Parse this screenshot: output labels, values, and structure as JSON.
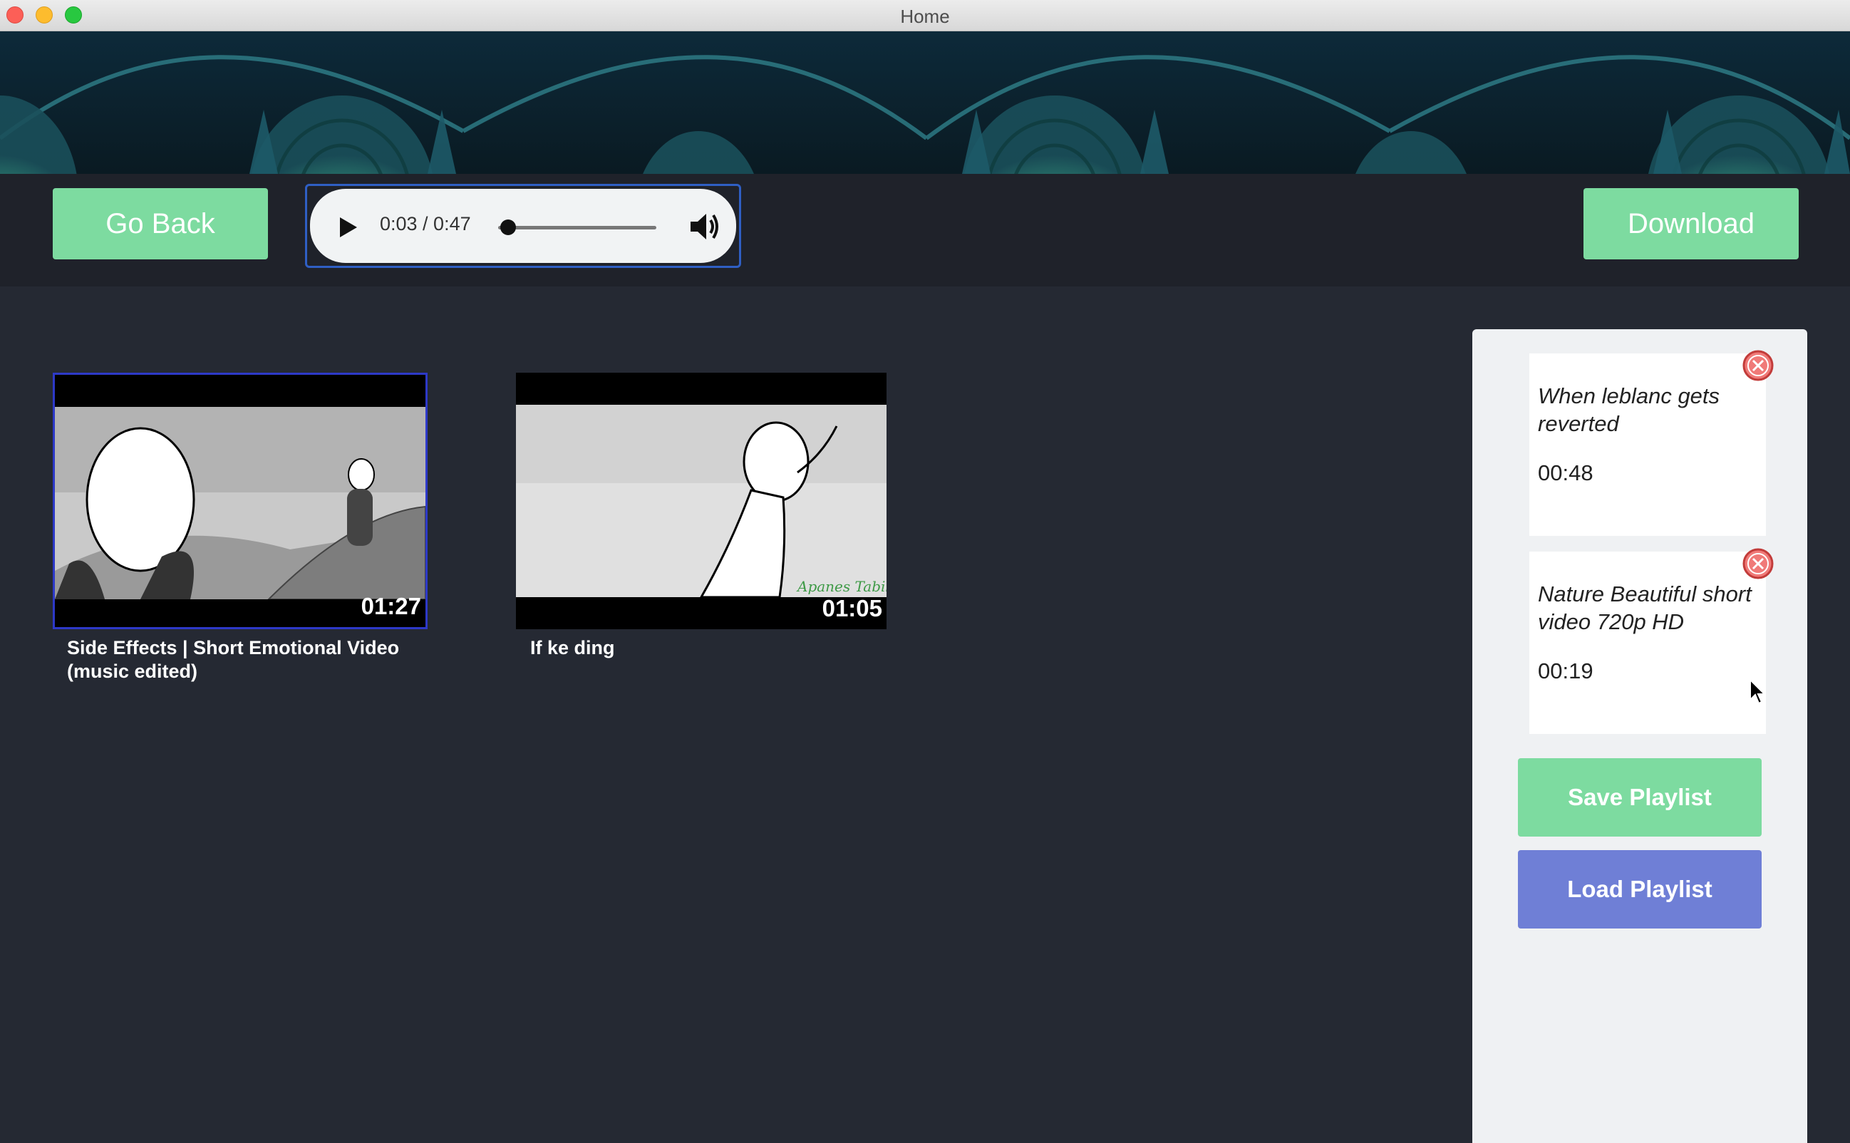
{
  "window": {
    "title": "Home"
  },
  "toolbar": {
    "go_back_label": "Go Back",
    "download_label": "Download"
  },
  "audio_player": {
    "time": "0:03 / 0:47",
    "progress": 0.064
  },
  "videos": [
    {
      "title": "Side Effects | Short Emotional Video (music edited)",
      "duration": "01:27",
      "selected": true
    },
    {
      "title": "If ke ding",
      "duration": "01:05",
      "selected": false
    }
  ],
  "playlist": {
    "items": [
      {
        "title": "When leblanc gets reverted",
        "duration": "00:48"
      },
      {
        "title": "Nature Beautiful short video 720p HD",
        "duration": "00:19"
      }
    ],
    "save_label": "Save Playlist",
    "load_label": "Load Playlist"
  },
  "colors": {
    "accent_green": "#7ddba0",
    "accent_blue": "#6f7fd6",
    "background": "#252933"
  }
}
